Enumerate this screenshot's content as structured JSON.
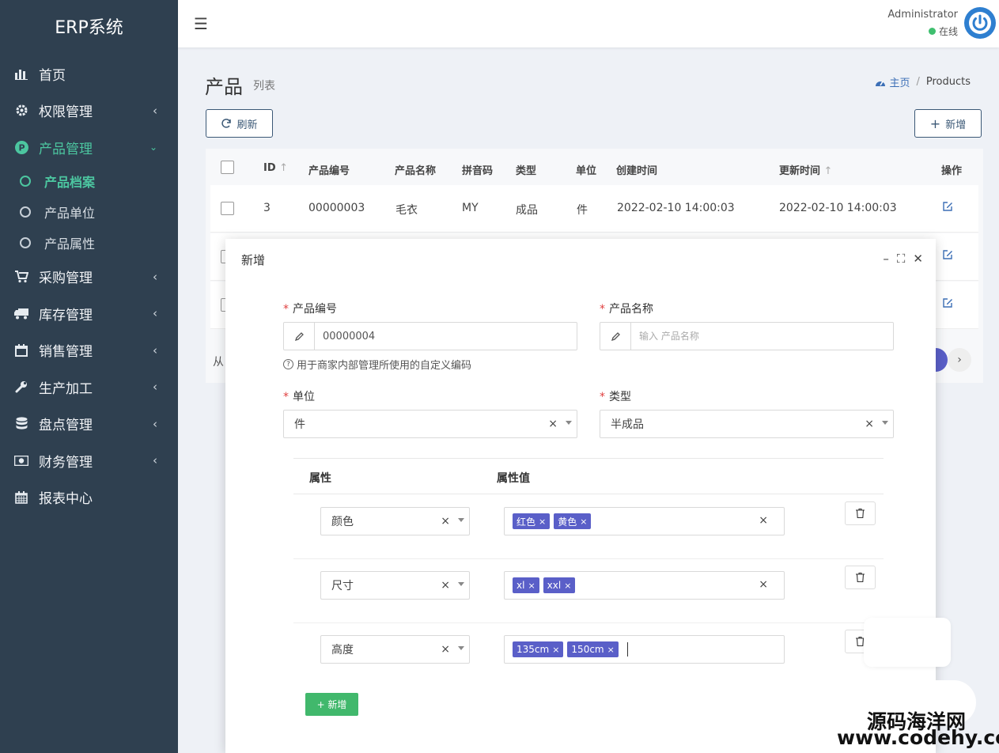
{
  "sidebar": {
    "brand": "ERP系统",
    "items": [
      {
        "label": "首页"
      },
      {
        "label": "权限管理"
      },
      {
        "label": "产品管理"
      },
      {
        "label": "采购管理"
      },
      {
        "label": "库存管理"
      },
      {
        "label": "销售管理"
      },
      {
        "label": "生产加工"
      },
      {
        "label": "盘点管理"
      },
      {
        "label": "财务管理"
      },
      {
        "label": "报表中心"
      }
    ],
    "sub_items": [
      {
        "label": "产品档案"
      },
      {
        "label": "产品单位"
      },
      {
        "label": "产品属性"
      }
    ],
    "accent_color": "#4cc6a0",
    "bg_color": "#2f4050"
  },
  "topbar": {
    "user_name": "Administrator",
    "status": "在线"
  },
  "page": {
    "title": "产品",
    "subtitle": "列表",
    "breadcrumb_home": "主页",
    "breadcrumb_current": "Products",
    "refresh_label": "刷新",
    "add_label": "新增"
  },
  "table": {
    "headers": [
      "ID",
      "产品编号",
      "产品名称",
      "拼音码",
      "类型",
      "单位",
      "创建时间",
      "更新时间",
      "操作"
    ],
    "rows": [
      {
        "id": "3",
        "code": "00000003",
        "name": "毛衣",
        "pinyin": "MY",
        "type": "成品",
        "unit": "件",
        "created": "2022-02-10 14:00:03",
        "updated": "2022-02-10 14:00:03"
      }
    ],
    "footer_text": "从"
  },
  "modal": {
    "title": "新增",
    "code_label": "产品编号",
    "code_value": "00000004",
    "name_label": "产品名称",
    "name_placeholder": "输入 产品名称",
    "help_text": "用于商家内部管理所使用的自定义编码",
    "unit_label": "单位",
    "unit_value": "件",
    "type_label": "类型",
    "type_value": "半成品",
    "attr_header": "属性",
    "attr_value_header": "属性值",
    "attributes": [
      {
        "name": "颜色",
        "values": [
          "红色",
          "黄色"
        ]
      },
      {
        "name": "尺寸",
        "values": [
          "xl",
          "xxl"
        ]
      },
      {
        "name": "高度",
        "values": [
          "135cm",
          "150cm"
        ]
      }
    ],
    "add_attr_label": "+ 新增",
    "clear_glyph": "×"
  },
  "watermark": {
    "line1": "源码海洋网",
    "line2": "www.codehy.com"
  }
}
